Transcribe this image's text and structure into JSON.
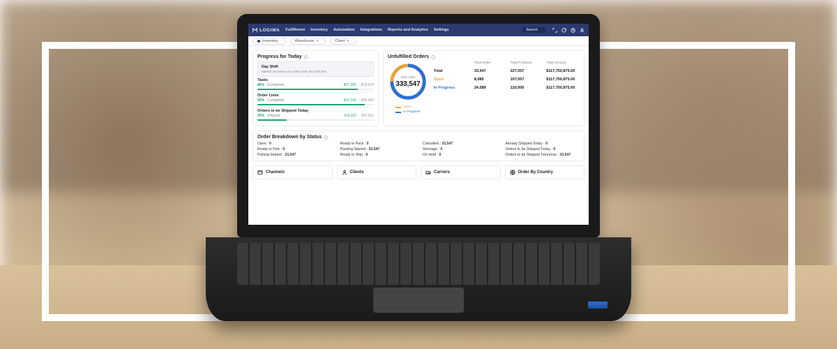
{
  "brand": "LOGIWA",
  "nav": [
    "Fulfillment",
    "Inventory",
    "Automation",
    "Integrations",
    "Reports and Analytics",
    "Settings"
  ],
  "search_label": "Search",
  "filters": {
    "f1": "Inventory",
    "f2": "Warehouse",
    "f3": "Client"
  },
  "progress": {
    "title": "Progress for Today",
    "shift_title": "Day Shift",
    "shift_sub": "Metrics are based on orders from the shift time.",
    "metrics": [
      {
        "name": "Tasks",
        "pct": "86%",
        "pct_label": "Completed",
        "done": "857,300",
        "total": "872,370",
        "bar": 86
      },
      {
        "name": "Order Lines",
        "pct": "92%",
        "pct_label": "Completed",
        "done": "822,192",
        "total": "826,420",
        "bar": 92
      },
      {
        "name": "Orders to be Shipped Today",
        "pct": "25%",
        "pct_label": "Shipped",
        "done": "919,322",
        "total": "917,511",
        "bar": 25
      }
    ]
  },
  "unfulfilled": {
    "title": "Unfulfilled Orders",
    "ring_label": "Total Order",
    "ring_value": "333,547",
    "legend_open": "Open",
    "legend_prog": "In Progress",
    "cols": [
      "Total Order",
      "Total Products",
      "Total Amount"
    ],
    "rows": [
      {
        "h": "Total",
        "v": [
          "33,547",
          "227,057",
          "$117,750,875.00"
        ]
      },
      {
        "h": "Open",
        "cls": "open",
        "v": [
          "8,985",
          "107,057",
          "$117,750,875.00"
        ]
      },
      {
        "h": "In Progress",
        "cls": "prog",
        "v": [
          "24,589",
          "120,000",
          "$117,750,875.00"
        ]
      }
    ]
  },
  "breakdown": {
    "title": "Order Breakdown by Status",
    "items": [
      "Open : 0",
      "Ready to Pack : 0",
      "Cancelled : 33,547",
      "Already Shipped Today : 0",
      "Ready to Pick : 0",
      "Packing Started : 33,547",
      "Shortage : 0",
      "Orders to be Shipped Today : 0",
      "Picking Started : 33,547",
      "Ready to Ship : 0",
      "On Hold : 0",
      "Orders to be Shipped Tomorrow : 33,547"
    ]
  },
  "panels": [
    "Channels",
    "Clients",
    "Carriers",
    "Order By Country"
  ]
}
